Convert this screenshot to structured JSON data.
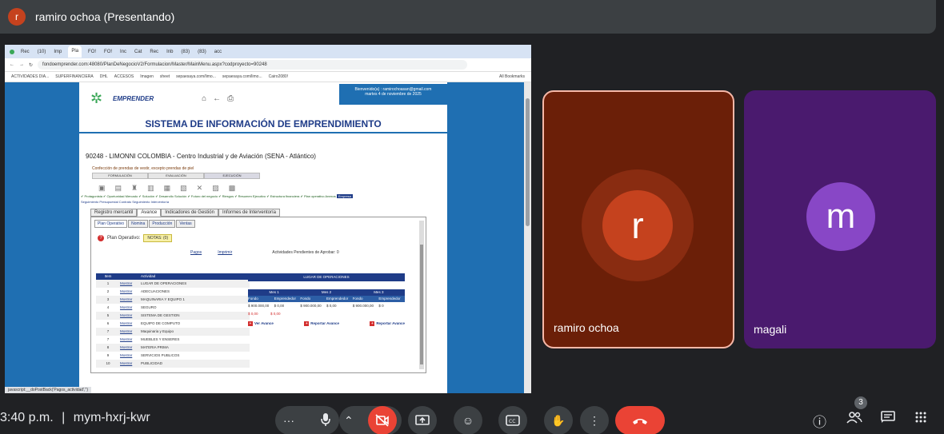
{
  "header": {
    "presenter_initial": "r",
    "title": "ramiro ochoa (Presentando)"
  },
  "browser": {
    "url": "fondoemprender.com:48080/PlanDeNegocioV2/Formulacion/Master/MainMenu.aspx?codproyecto=90248",
    "bookmarks": [
      "ACTIVIDADES DIA...",
      "SUPERFINANCIERA",
      "DHL",
      "ACCESOS",
      "Imagen",
      "sheet",
      "sepaesaya.com/limo...",
      "sepaesaya.com/limo...",
      "Cairo2080!"
    ],
    "all_bookmarks": "All Bookmarks",
    "tabs": [
      "Rec",
      "(10)",
      "Imp",
      "Pla",
      "FO!",
      "FO!",
      "Inc",
      "Cat",
      "Rec",
      "Inb",
      "(83)",
      "(83)",
      "acc"
    ]
  },
  "site": {
    "logo_text": "EMPRENDER",
    "welcome": "Bienvenido(a) : ramirochoasan@gmail.com",
    "date": "martes 4 de noviembre de 2025",
    "system_title": "SISTEMA DE INFORMACIÓN DE EMPRENDIMIENTO",
    "project_title": "90248 - LIMONNI COLOMBIA - Centro Industrial y de Aviación (SENA - Atlántico)",
    "project_sub": "Confección de prendas de vestir, excepto prendas de piel",
    "phases": [
      "FORMULACIÓN",
      "EVALUACIÓN",
      "EJECUCIÓN"
    ],
    "checks": "✔ Protagonista ✔ Oportunidad Mercado ✔ Solución ✔ Desarrollo Solución ✔ Futuro del negocio ✔ Riesgos ✔ Resumen Ejecutivo ✔ Estructura financiera ✔ Plan operativo   Anexos",
    "empresa": "Empresa",
    "checks2": "Seguimiento Presupuestal   Contrato   Seguimiento Interventoría",
    "tabs1": [
      "Registro mercantil",
      "Avance",
      "Indicadores de Gestión",
      "Informes de Interventoría"
    ],
    "tabs2": [
      "Plan Operativo",
      "Nomina",
      "Producción",
      "Ventas"
    ],
    "plan_label": "Plan Operativo:",
    "notas": "NOTAS:",
    "notas_count": "(0)",
    "pagos": "Pagos",
    "imprimir": "Imprimir",
    "pendientes": "Actividades Pendientes de Aprobar: 0",
    "table_headers": [
      "Item",
      "Actividad"
    ],
    "mostrar": "Mostrar",
    "activities": [
      {
        "item": "1",
        "name": "LUGAR DE OPERACIONES"
      },
      {
        "item": "2",
        "name": "ADECUACIONES"
      },
      {
        "item": "3",
        "name": "MAQUINARIA Y EQUIPO 1"
      },
      {
        "item": "4",
        "name": "SEGURO"
      },
      {
        "item": "5",
        "name": "SISTEMA DE GESTION"
      },
      {
        "item": "6",
        "name": "EQUIPO DE COMPUTO"
      },
      {
        "item": "7",
        "name": "Maquinaria y Equipo"
      },
      {
        "item": "7",
        "name": "MUEBLES Y ENSERES"
      },
      {
        "item": "8",
        "name": "MATERIA PRIMA"
      },
      {
        "item": "9",
        "name": "SERVICIOS PUBLICOS"
      },
      {
        "item": "10",
        "name": "PUBLICIDAD"
      }
    ],
    "lugar_title": "LUGAR DE OPERACIONES",
    "months": [
      "Mes 1",
      "Mes 2",
      "Mes 3"
    ],
    "sub_headers": [
      "Fondo",
      "Emprendedor",
      "Fondo",
      "Emprendedor",
      "Fondo",
      "Emprendedor"
    ],
    "values": [
      "$ 900.000,00",
      "$ 0,00",
      "$ 900.000,00",
      "$ 0,00",
      "$ 900.000,00",
      "$ 0"
    ],
    "red_values": [
      "$ 0,00",
      "$ 0,00"
    ],
    "actions": [
      "Ver Avance",
      "Reportar Avance",
      "Reportar Avance"
    ],
    "status_url": "javascript:__doPostBack('Pagos_actividad','')"
  },
  "participants": [
    {
      "initial": "r",
      "name": "ramiro ochoa",
      "color": "#c5421e"
    },
    {
      "initial": "m",
      "name": "magali",
      "color": "#8847c6"
    }
  ],
  "footer": {
    "time": "3:40 p.m.",
    "separator": "|",
    "meeting_code": "mym-hxrj-kwr",
    "people_count": "3"
  }
}
